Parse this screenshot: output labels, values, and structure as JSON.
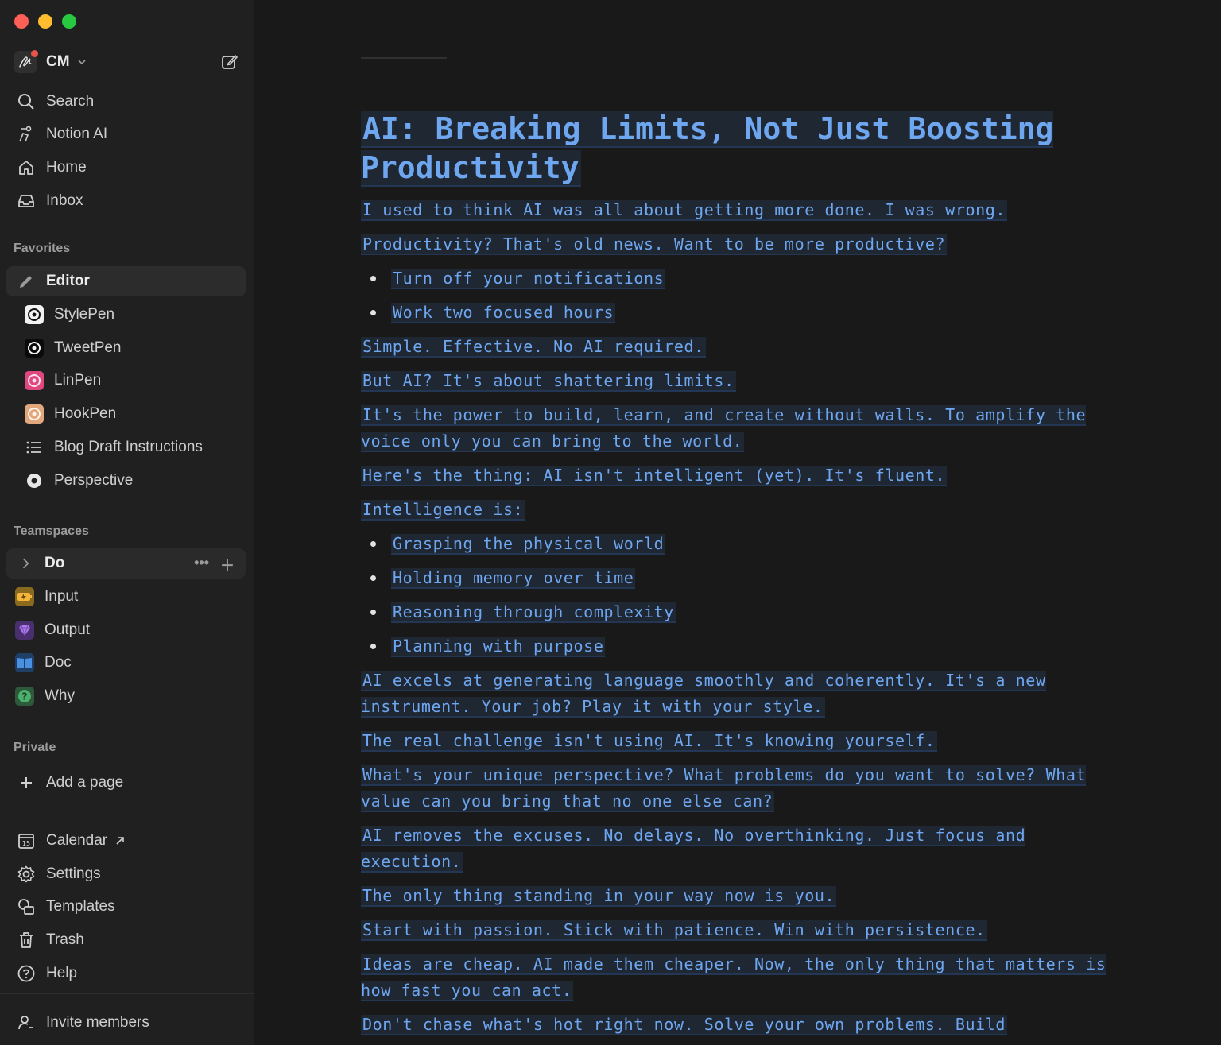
{
  "workspace": {
    "name": "CM"
  },
  "nav": {
    "search": "Search",
    "notion_ai": "Notion AI",
    "home": "Home",
    "inbox": "Inbox"
  },
  "favorites": {
    "label": "Favorites",
    "items": [
      {
        "label": "Editor",
        "icon": "pencil-icon"
      },
      {
        "label": "StylePen",
        "icon": "target-icon"
      },
      {
        "label": "TweetPen",
        "icon": "target-icon"
      },
      {
        "label": "LinPen",
        "icon": "target-icon"
      },
      {
        "label": "HookPen",
        "icon": "target-icon"
      },
      {
        "label": "Blog Draft Instructions",
        "icon": "list-icon"
      },
      {
        "label": "Perspective",
        "icon": "circle-icon"
      }
    ]
  },
  "teamspaces": {
    "label": "Teamspaces",
    "items": [
      {
        "label": "Do"
      },
      {
        "label": "Input"
      },
      {
        "label": "Output"
      },
      {
        "label": "Doc"
      },
      {
        "label": "Why"
      }
    ]
  },
  "private": {
    "label": "Private",
    "add_page": "Add a page"
  },
  "footer": {
    "calendar": "Calendar",
    "settings": "Settings",
    "templates": "Templates",
    "trash": "Trash",
    "help": "Help",
    "invite": "Invite members"
  },
  "doc": {
    "title": "AI: Breaking Limits, Not Just Boosting Productivity",
    "p1": "I used to think AI was all about getting more done. I was wrong.",
    "p2": "Productivity? That's old news. Want to be more productive?",
    "list1": [
      "Turn off your notifications",
      "Work two focused hours"
    ],
    "p3": "Simple. Effective. No AI required.",
    "p4": "But AI? It's about shattering limits.",
    "p5": "It's the power to build, learn, and create without walls. To amplify the voice only you can bring to the world.",
    "p6": "Here's the thing: AI isn't intelligent (yet). It's fluent.",
    "p7": "Intelligence is:",
    "list2": [
      "Grasping the physical world",
      "Holding memory over time",
      "Reasoning through complexity",
      "Planning with purpose"
    ],
    "p8": "AI excels at generating language smoothly and coherently. It's a new instrument. Your job? Play it with your style.",
    "p9": "The real challenge isn't using AI. It's knowing yourself.",
    "p10": "What's your unique perspective? What problems do you want to solve? What value can you bring that no one else can?",
    "p11": "AI removes the excuses. No delays. No overthinking. Just focus and execution.",
    "p12": "The only thing standing in your way now is you.",
    "p13": "Start with passion. Stick with patience. Win with persistence.",
    "p14": "Ideas are cheap. AI made them cheaper. Now, the only thing that matters is how fast you can act.",
    "p15": "Don't chase what's hot right now. Solve your own problems. Build"
  }
}
